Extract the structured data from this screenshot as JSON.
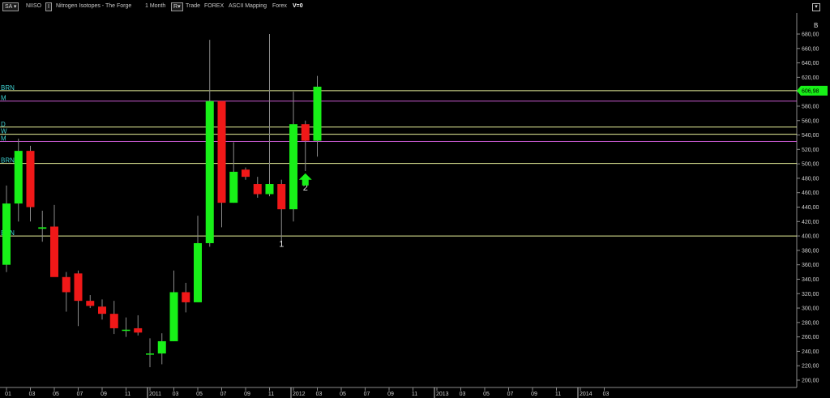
{
  "toolbar": {
    "symbol_box": "SA",
    "symbol": "NIISO",
    "info_box": "I",
    "name": "Nitrogen Isotopes - The Forge",
    "period": "1 Month",
    "r_box": "R",
    "mode": "Trade",
    "market": "FOREX",
    "mapping": "ASCII Mapping",
    "forex": "Forex",
    "volume": "V=0",
    "right_button": "▾",
    "b_label": "B"
  },
  "chart_data": {
    "type": "candlestick",
    "ylim": [
      190,
      700
    ],
    "y_ticks": [
      200,
      220,
      240,
      260,
      280,
      300,
      320,
      340,
      360,
      380,
      400,
      420,
      440,
      460,
      480,
      500,
      520,
      540,
      560,
      580,
      600,
      620,
      640,
      660,
      680
    ],
    "y_tick_labels": [
      "200,00",
      "220,00",
      "240,00",
      "260,00",
      "280,00",
      "300,00",
      "320,00",
      "340,00",
      "360,00",
      "380,00",
      "400,00",
      "420,00",
      "440,00",
      "460,00",
      "480,00",
      "500,00",
      "520,00",
      "540,00",
      "560,00",
      "580,00",
      "600,00",
      "620,00",
      "640,00",
      "660,00",
      "680,00"
    ],
    "x_labels": [
      "01",
      "03",
      "05",
      "07",
      "09",
      "11",
      "2011",
      "03",
      "05",
      "07",
      "09",
      "11",
      "2012",
      "03",
      "05",
      "07",
      "09",
      "11",
      "2013",
      "03",
      "05",
      "07",
      "09",
      "11",
      "2014",
      "03"
    ],
    "year_labels": [
      "2011",
      "2012",
      "2013",
      "2014"
    ],
    "last_price": "606,98",
    "colors": {
      "up": "#18f018",
      "down": "#f01818",
      "level_yellow": "#e8f09a",
      "level_magenta": "#c85ad0",
      "grid": "#2a2a2a",
      "axis": "#8a8a8a",
      "price_tag": "#18f018"
    },
    "candles": [
      {
        "o": 360,
        "h": 470,
        "l": 350,
        "c": 445
      },
      {
        "o": 445,
        "h": 535,
        "l": 420,
        "c": 518
      },
      {
        "o": 518,
        "h": 525,
        "l": 420,
        "c": 440
      },
      {
        "o": 410,
        "h": 435,
        "l": 392,
        "c": 412
      },
      {
        "o": 413,
        "h": 443,
        "l": 395,
        "c": 343
      },
      {
        "o": 343,
        "h": 350,
        "l": 295,
        "c": 322
      },
      {
        "o": 348,
        "h": 352,
        "l": 275,
        "c": 310
      },
      {
        "o": 310,
        "h": 318,
        "l": 300,
        "c": 303
      },
      {
        "o": 302,
        "h": 312,
        "l": 284,
        "c": 292
      },
      {
        "o": 292,
        "h": 310,
        "l": 264,
        "c": 272
      },
      {
        "o": 270,
        "h": 287,
        "l": 260,
        "c": 270
      },
      {
        "o": 272,
        "h": 290,
        "l": 262,
        "c": 266
      },
      {
        "o": 237,
        "h": 258,
        "l": 218,
        "c": 237
      },
      {
        "o": 237,
        "h": 265,
        "l": 222,
        "c": 254
      },
      {
        "o": 254,
        "h": 352,
        "l": 254,
        "c": 322
      },
      {
        "o": 322,
        "h": 335,
        "l": 294,
        "c": 308
      },
      {
        "o": 308,
        "h": 428,
        "l": 308,
        "c": 390
      },
      {
        "o": 390,
        "h": 672,
        "l": 385,
        "c": 587
      },
      {
        "o": 587,
        "h": 587,
        "l": 412,
        "c": 446
      },
      {
        "o": 446,
        "h": 530,
        "l": 446,
        "c": 489
      },
      {
        "o": 492,
        "h": 495,
        "l": 478,
        "c": 482
      },
      {
        "o": 472,
        "h": 482,
        "l": 453,
        "c": 458
      },
      {
        "o": 458,
        "h": 680,
        "l": 455,
        "c": 472
      },
      {
        "o": 472,
        "h": 478,
        "l": 390,
        "c": 437
      },
      {
        "o": 437,
        "h": 600,
        "l": 420,
        "c": 555
      },
      {
        "o": 555,
        "h": 560,
        "l": 490,
        "c": 532
      },
      {
        "o": 532,
        "h": 622,
        "l": 510,
        "c": 607
      }
    ],
    "levels": [
      {
        "label": "BRN",
        "value": 601.5,
        "color": "level_yellow"
      },
      {
        "label": "M",
        "value": 587,
        "color": "level_magenta"
      },
      {
        "label": "D",
        "value": 551,
        "color": "level_yellow"
      },
      {
        "label": "W",
        "value": 541,
        "color": "level_yellow"
      },
      {
        "label": "M",
        "value": 531,
        "color": "level_magenta"
      },
      {
        "label": "BRN",
        "value": 500.5,
        "color": "level_yellow"
      },
      {
        "label": "BRN",
        "value": 400,
        "color": "level_yellow"
      }
    ],
    "annotations": [
      {
        "text": "1",
        "candle": 23,
        "value": 385
      },
      {
        "text": "2",
        "candle": 25,
        "value": 463
      }
    ],
    "arrow": {
      "candle": 25,
      "value": 478
    }
  }
}
